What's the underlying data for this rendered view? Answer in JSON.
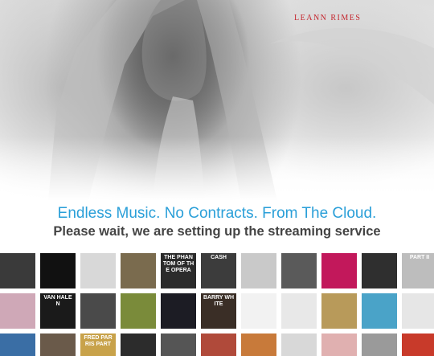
{
  "hero": {
    "artist_logo": "LEANN RIMES"
  },
  "headline": "Endless Music. No Contracts. From The Cloud.",
  "status": "Please wait, we are setting up the streaming service",
  "colors": {
    "headline": "#2a9fd8",
    "status": "#444444",
    "artist_logo": "#c4262e"
  },
  "covers": [
    {
      "text": "",
      "color": "#3a3a3a"
    },
    {
      "text": "",
      "color": "#111111"
    },
    {
      "text": "",
      "color": "#d8d8d8"
    },
    {
      "text": "",
      "color": "#7a6b4e"
    },
    {
      "text": "THE PHANTOM OF THE OPERA",
      "color": "#2b2b2b"
    },
    {
      "text": "CASH",
      "color": "#3c3c3c"
    },
    {
      "text": "",
      "color": "#c9c9c9"
    },
    {
      "text": "",
      "color": "#5a5a5a"
    },
    {
      "text": "",
      "color": "#c2185b"
    },
    {
      "text": "",
      "color": "#2f2f2f"
    },
    {
      "text": "PART II",
      "color": "#bdbdbd"
    },
    {
      "text": "",
      "color": "#cfa8b7"
    },
    {
      "text": "VAN HALEN",
      "color": "#1a1a1a"
    },
    {
      "text": "",
      "color": "#4a4a4a"
    },
    {
      "text": "",
      "color": "#7a8b3a"
    },
    {
      "text": "",
      "color": "#1c1c24"
    },
    {
      "text": "BARRY WHITE",
      "color": "#3a2e26"
    },
    {
      "text": "",
      "color": "#f2f2f2"
    },
    {
      "text": "",
      "color": "#e8e8e8"
    },
    {
      "text": "",
      "color": "#b89a5a"
    },
    {
      "text": "",
      "color": "#4aa3c8"
    },
    {
      "text": "",
      "color": "#e6e6e6"
    },
    {
      "text": "",
      "color": "#3a6ea5"
    },
    {
      "text": "",
      "color": "#6a5a4a"
    },
    {
      "text": "FRED PARRIS PART",
      "color": "#c8a24a"
    },
    {
      "text": "",
      "color": "#2c2c2c"
    },
    {
      "text": "",
      "color": "#555555"
    },
    {
      "text": "",
      "color": "#b04a3a"
    },
    {
      "text": "",
      "color": "#c87a3a"
    },
    {
      "text": "",
      "color": "#d8d8d8"
    },
    {
      "text": "",
      "color": "#e0b0b0"
    },
    {
      "text": "",
      "color": "#9a9a9a"
    },
    {
      "text": "",
      "color": "#c83a2a"
    }
  ]
}
